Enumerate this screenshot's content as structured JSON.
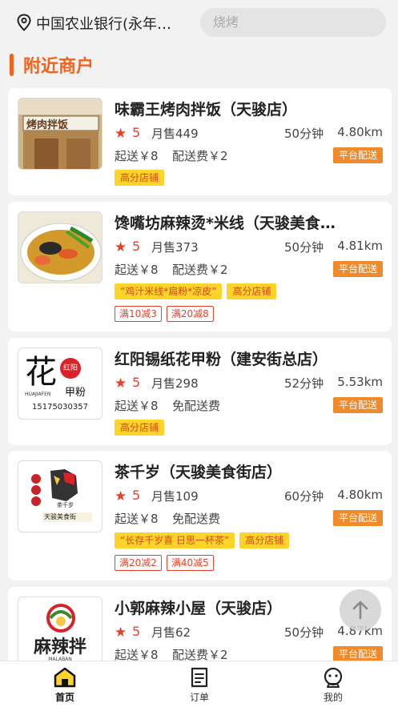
{
  "header": {
    "location": "中国农业银行(永年…",
    "search_placeholder": "烧烤"
  },
  "section_title": "附近商户",
  "shops": [
    {
      "name": "味霸王烤肉拌饭（天骏店）",
      "rating": "5",
      "monthly_sales": "月售449",
      "delivery_time": "50分钟",
      "distance": "4.80km",
      "min_order": "起送￥8",
      "delivery_fee": "配送费￥2",
      "platform_tag": "平台配送",
      "sign_text": "烤肉拌饭",
      "tags": [
        "高分店铺"
      ],
      "discounts": []
    },
    {
      "name": "馋嘴坊麻辣烫*米线（天骏美食…",
      "rating": "5",
      "monthly_sales": "月售373",
      "delivery_time": "50分钟",
      "distance": "4.81km",
      "min_order": "起送￥8",
      "delivery_fee": "配送费￥2",
      "platform_tag": "平台配送",
      "tags": [
        "“鸡汁米线*扁粉*凉皮”",
        "高分店铺"
      ],
      "discounts": [
        "满10减3",
        "满20减8"
      ]
    },
    {
      "name": "红阳锡纸花甲粉（建安街总店）",
      "rating": "5",
      "monthly_sales": "月售298",
      "delivery_time": "52分钟",
      "distance": "5.53km",
      "min_order": "起送￥8",
      "delivery_fee": "免配送费",
      "platform_tag": "平台配送",
      "logo_main": "花",
      "logo_sub": "HUAJIAFEN",
      "logo_red": "红阳",
      "logo_side": "甲粉",
      "logo_phone": "15175030357",
      "tags": [
        "高分店铺"
      ],
      "discounts": []
    },
    {
      "name": "茶千岁（天骏美食街店）",
      "rating": "5",
      "monthly_sales": "月售109",
      "delivery_time": "60分钟",
      "distance": "4.80km",
      "min_order": "起送￥8",
      "delivery_fee": "免配送费",
      "platform_tag": "平台配送",
      "logo_caption": "天骏美食街",
      "logo_small": "茶千岁",
      "tags": [
        "“长存千岁喜 日思一杯茶”",
        "高分店铺"
      ],
      "discounts": [
        "满20减2",
        "满40减5"
      ]
    },
    {
      "name": "小郭麻辣小屋（天骏店）",
      "rating": "5",
      "monthly_sales": "月售62",
      "delivery_time": "50分钟",
      "distance": "4.87km",
      "min_order": "起送￥8",
      "delivery_fee": "配送费￥2",
      "platform_tag": "平台配送",
      "logo_text": "麻辣拌",
      "logo_sub": "MALABAN",
      "tags": [],
      "discounts": []
    }
  ],
  "tabbar": {
    "home": "首页",
    "orders": "订单",
    "mine": "我的"
  },
  "colors": {
    "accent": "#f0641e",
    "star": "#e8402a",
    "platform_tag": "#f08a2a",
    "yellow_tag": "#ffd42a"
  }
}
